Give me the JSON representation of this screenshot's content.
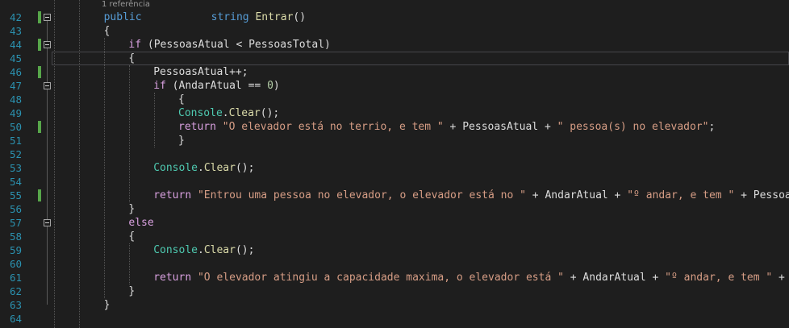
{
  "editor": {
    "codelens": "1 referência",
    "lines": [
      {
        "num": "42",
        "changed": true,
        "fold": true,
        "tokens": [
          [
            "kw",
            "public"
          ],
          [
            "",
            "           "
          ],
          [
            "kw",
            "string"
          ],
          [
            "",
            " "
          ],
          [
            "mth",
            "Entrar"
          ],
          [
            "",
            "()"
          ]
        ]
      },
      {
        "num": "43",
        "changed": false,
        "fold": false,
        "tokens": [
          [
            "",
            "{"
          ]
        ]
      },
      {
        "num": "44",
        "changed": true,
        "fold": true,
        "tokens": [
          [
            "kwc",
            "if"
          ],
          [
            "",
            " (PessoasAtual < PessoasTotal)"
          ]
        ]
      },
      {
        "num": "45",
        "changed": false,
        "fold": false,
        "tokens": [
          [
            "",
            "{"
          ]
        ]
      },
      {
        "num": "46",
        "changed": true,
        "fold": false,
        "tokens": [
          [
            "",
            "PessoasAtual++;"
          ]
        ]
      },
      {
        "num": "47",
        "changed": false,
        "fold": true,
        "tokens": [
          [
            "kwc",
            "if"
          ],
          [
            "",
            " (AndarAtual == "
          ],
          [
            "num",
            "0"
          ],
          [
            "",
            ")"
          ]
        ]
      },
      {
        "num": "48",
        "changed": false,
        "fold": false,
        "tokens": [
          [
            "",
            "{"
          ]
        ]
      },
      {
        "num": "49",
        "changed": false,
        "fold": false,
        "tokens": [
          [
            "cls",
            "Console"
          ],
          [
            "",
            "."
          ],
          [
            "mth",
            "Clear"
          ],
          [
            "",
            "();"
          ]
        ]
      },
      {
        "num": "50",
        "changed": true,
        "fold": false,
        "tokens": [
          [
            "kwc",
            "return"
          ],
          [
            "",
            " "
          ],
          [
            "str",
            "\"O elevador está no terrio, e tem \""
          ],
          [
            "",
            " + PessoasAtual + "
          ],
          [
            "str",
            "\" pessoa(s) no elevador\""
          ],
          [
            "",
            ";"
          ]
        ]
      },
      {
        "num": "51",
        "changed": false,
        "fold": false,
        "tokens": [
          [
            "",
            "}"
          ]
        ]
      },
      {
        "num": "52",
        "changed": false,
        "fold": false,
        "tokens": []
      },
      {
        "num": "53",
        "changed": false,
        "fold": false,
        "tokens": [
          [
            "cls",
            "Console"
          ],
          [
            "",
            "."
          ],
          [
            "mth",
            "Clear"
          ],
          [
            "",
            "();"
          ]
        ]
      },
      {
        "num": "54",
        "changed": false,
        "fold": false,
        "tokens": []
      },
      {
        "num": "55",
        "changed": true,
        "fold": false,
        "tokens": [
          [
            "kwc",
            "return"
          ],
          [
            "",
            " "
          ],
          [
            "str",
            "\"Entrou uma pessoa no elevador, o elevador está no \""
          ],
          [
            "",
            " + AndarAtual + "
          ],
          [
            "str",
            "\"º andar, e tem \""
          ],
          [
            "",
            " + PessoasAt"
          ]
        ]
      },
      {
        "num": "56",
        "changed": false,
        "fold": false,
        "tokens": [
          [
            "",
            "}"
          ]
        ]
      },
      {
        "num": "57",
        "changed": false,
        "fold": true,
        "tokens": [
          [
            "kwc",
            "else"
          ]
        ]
      },
      {
        "num": "58",
        "changed": false,
        "fold": false,
        "tokens": [
          [
            "",
            "{"
          ]
        ]
      },
      {
        "num": "59",
        "changed": false,
        "fold": false,
        "tokens": [
          [
            "cls",
            "Console"
          ],
          [
            "",
            "."
          ],
          [
            "mth",
            "Clear"
          ],
          [
            "",
            "();"
          ]
        ]
      },
      {
        "num": "60",
        "changed": false,
        "fold": false,
        "tokens": []
      },
      {
        "num": "61",
        "changed": false,
        "fold": false,
        "tokens": [
          [
            "kwc",
            "return"
          ],
          [
            "",
            " "
          ],
          [
            "str",
            "\"O elevador atingiu a capacidade maxima, o elevador está \""
          ],
          [
            "",
            " + AndarAtual + "
          ],
          [
            "str",
            "\"º andar, e tem \""
          ],
          [
            "",
            " + Pes"
          ]
        ]
      },
      {
        "num": "62",
        "changed": false,
        "fold": false,
        "tokens": [
          [
            "",
            "}"
          ]
        ]
      },
      {
        "num": "63",
        "changed": false,
        "fold": false,
        "tokens": [
          [
            "",
            "}"
          ]
        ]
      },
      {
        "num": "64",
        "changed": false,
        "fold": false,
        "tokens": []
      }
    ]
  },
  "colors": {
    "background": "#1e1e1e",
    "line_number": "#2b91af",
    "keyword": "#569cd6",
    "control_keyword": "#d8a0df",
    "string": "#d69d85",
    "class": "#4ec9b0",
    "method": "#dcdcaa",
    "number": "#b5cea8",
    "text": "#dcdcdc",
    "change_bar": "#57a64a"
  }
}
